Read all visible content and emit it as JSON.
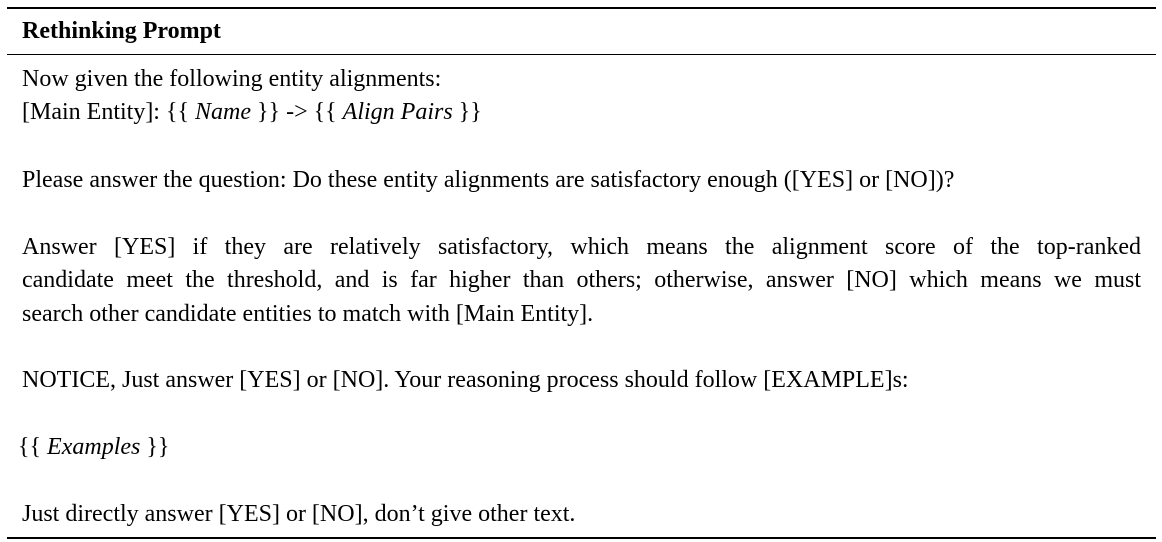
{
  "header": {
    "title": "Rethinking Prompt"
  },
  "body": {
    "intro_line": "Now given the following entity alignments:",
    "main_entity_label": "[Main Entity]:",
    "open_braces": "{{",
    "close_braces": "}}",
    "arrow": "->",
    "var_name": "Name",
    "var_align_pairs": "Align Pairs",
    "question_line": "Please answer the question: Do these entity alignments are satisfactory enough ([YES] or [NO])?",
    "answer_line_1": "Answer [YES] if they are relatively satisfactory, which means the alignment score of the top-ranked",
    "answer_line_2": "candidate meet the threshold, and is far higher than others; otherwise, answer [NO] which means we must",
    "answer_line_3": "search other candidate entities to match with [Main Entity].",
    "notice_line": "NOTICE, Just answer [YES] or [NO]. Your reasoning process should follow [EXAMPLE]s:",
    "var_examples": "Examples",
    "final_line": "Just directly answer [YES] or [NO], don’t give other text."
  }
}
